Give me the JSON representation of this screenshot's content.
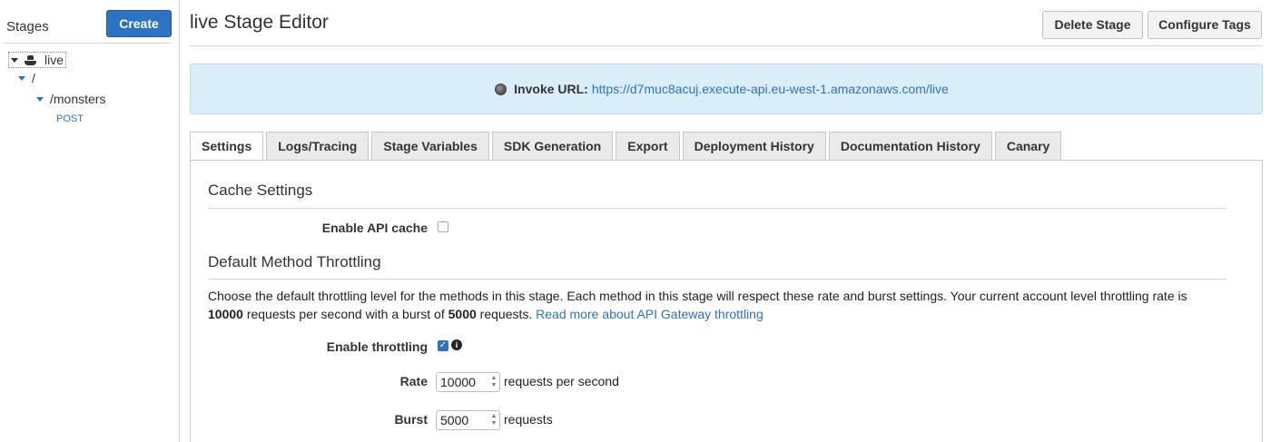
{
  "sidebar": {
    "title": "Stages",
    "create_label": "Create",
    "tree": {
      "stage": "live",
      "root": "/",
      "resource": "/monsters",
      "method": "POST"
    }
  },
  "header": {
    "title": "live Stage Editor",
    "delete_label": "Delete Stage",
    "tags_label": "Configure Tags"
  },
  "invoke": {
    "label": "Invoke URL:",
    "url": "https://d7muc8acuj.execute-api.eu-west-1.amazonaws.com/live"
  },
  "tabs": [
    {
      "label": "Settings",
      "active": true
    },
    {
      "label": "Logs/Tracing"
    },
    {
      "label": "Stage Variables"
    },
    {
      "label": "SDK Generation"
    },
    {
      "label": "Export"
    },
    {
      "label": "Deployment History"
    },
    {
      "label": "Documentation History"
    },
    {
      "label": "Canary"
    }
  ],
  "cache": {
    "heading": "Cache Settings",
    "enable_label": "Enable API cache",
    "enabled": false
  },
  "throttling": {
    "heading": "Default Method Throttling",
    "desc_part1": "Choose the default throttling level for the methods in this stage. Each method in this stage will respect these rate and burst settings. Your current account level throttling rate is ",
    "desc_rate": "10000",
    "desc_part2": " requests per second with a burst of ",
    "desc_burst": "5000",
    "desc_part3": " requests. ",
    "read_more": "Read more about API Gateway throttling",
    "enable_label": "Enable throttling",
    "enabled": true,
    "rate_label": "Rate",
    "rate_value": "10000",
    "rate_unit": "requests per second",
    "burst_label": "Burst",
    "burst_value": "5000",
    "burst_unit": "requests"
  },
  "colors": {
    "accent": "#2d73c4",
    "invoke_bg": "#d9eef8"
  }
}
